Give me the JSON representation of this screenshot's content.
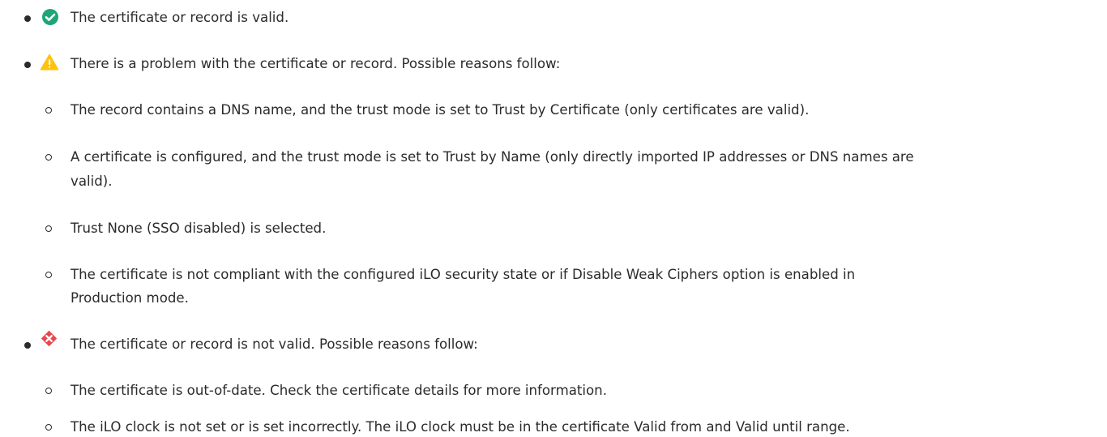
{
  "status_list": {
    "valid": {
      "icon": "check-circle-icon",
      "color": "#1fa57a",
      "text": "The certificate or record is valid."
    },
    "problem": {
      "icon": "warning-triangle-icon",
      "color": "#ffc20e",
      "text": "There is a problem with the certificate or record. Possible reasons follow:",
      "reasons": [
        {
          "line1": "The record contains a DNS name, and the trust mode is set to   Trust by Certificate (only certificates are valid)."
        },
        {
          "line1": "A certificate is configured, and the trust mode is set to   Trust by Name (only directly imported IP addresses or DNS names are",
          "line2": "valid)."
        },
        {
          "line1": "Trust None (SSO disabled) is selected."
        },
        {
          "line1": "The certificate is not compliant with the configured  iLO security state or if  Disable Weak Ciphers option is enabled in",
          "line2": "Production mode."
        }
      ]
    },
    "invalid": {
      "icon": "error-diamond-icon",
      "color": "#e5484d",
      "text": "The certificate or record is not valid. Possible reasons follow:",
      "reasons": [
        {
          "line1": "The certificate is out-of-date. Check the certificate details for more information."
        },
        {
          "line1": "The iLO clock is not set or is set incorrectly. The  iLO clock must be in the certificate  Valid from and Valid until range."
        }
      ]
    }
  }
}
